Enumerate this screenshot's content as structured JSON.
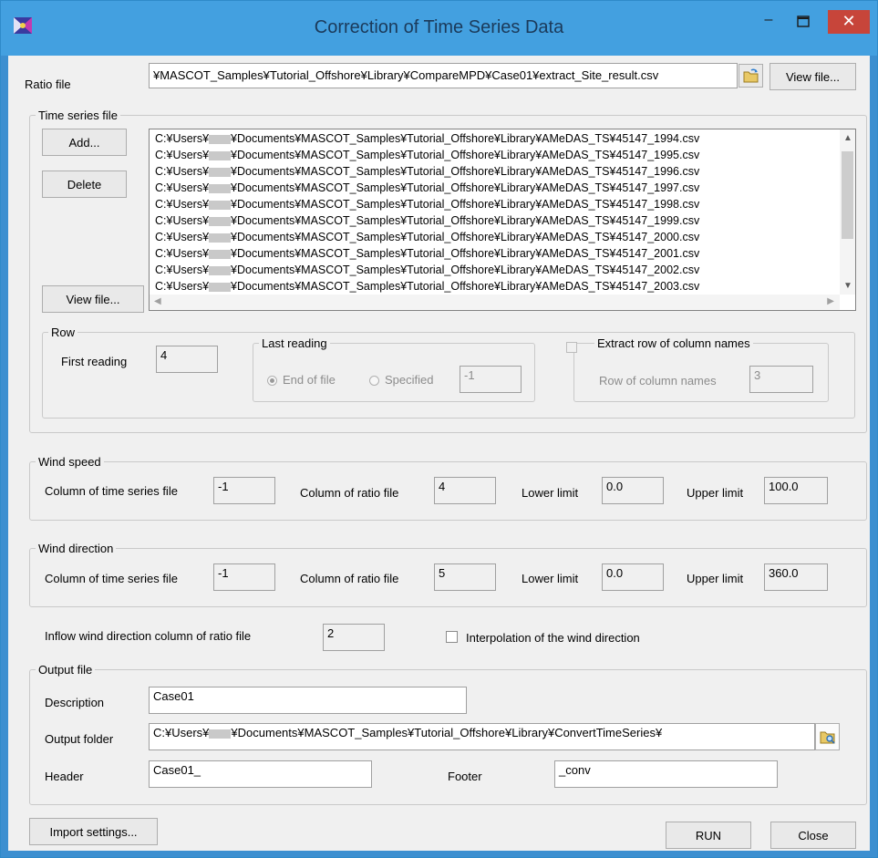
{
  "window": {
    "title": "Correction of Time Series Data",
    "minimize_glyph": "–",
    "maximize_glyph": "□",
    "close_glyph": "✕"
  },
  "ratio_file": {
    "label": "Ratio file",
    "value": "¥MASCOT_Samples¥Tutorial_Offshore¥Library¥CompareMPD¥Case01¥extract_Site_result.csv",
    "view_button": "View file..."
  },
  "time_series": {
    "legend": "Time series file",
    "add_button": "Add...",
    "delete_button": "Delete",
    "view_button": "View file...",
    "path_prefix": "C:¥Users¥",
    "path_suffix_base": "¥Documents¥MASCOT_Samples¥Tutorial_Offshore¥Library¥AMeDAS_TS¥",
    "files": [
      "45147_1994.csv",
      "45147_1995.csv",
      "45147_1996.csv",
      "45147_1997.csv",
      "45147_1998.csv",
      "45147_1999.csv",
      "45147_2000.csv",
      "45147_2001.csv",
      "45147_2002.csv",
      "45147_2003.csv"
    ]
  },
  "row": {
    "legend": "Row",
    "first_reading_label": "First reading",
    "first_reading_value": "4",
    "last_reading_legend": "Last reading",
    "end_of_file_label": "End of file",
    "specified_label": "Specified",
    "specified_value": "-1",
    "selected": "End of file",
    "extract_legend": "Extract row of column names",
    "row_of_column_names_label": "Row of column names",
    "row_of_column_names_value": "3"
  },
  "wind_speed": {
    "legend": "Wind speed",
    "col_ts_label": "Column of time series file",
    "col_ts_value": "-1",
    "col_ratio_label": "Column of ratio file",
    "col_ratio_value": "4",
    "lower_label": "Lower limit",
    "lower_value": "0.0",
    "upper_label": "Upper limit",
    "upper_value": "100.0"
  },
  "wind_direction": {
    "legend": "Wind direction",
    "col_ts_label": "Column of time series file",
    "col_ts_value": "-1",
    "col_ratio_label": "Column of ratio file",
    "col_ratio_value": "5",
    "lower_label": "Lower limit",
    "lower_value": "0.0",
    "upper_label": "Upper limit",
    "upper_value": "360.0"
  },
  "inflow": {
    "label": "Inflow wind direction column of ratio file",
    "value": "2",
    "interpolation_label": "Interpolation of the wind direction",
    "interpolation_checked": false
  },
  "output": {
    "legend": "Output file",
    "description_label": "Description",
    "description_value": "Case01",
    "folder_label": "Output folder",
    "folder_prefix": "C:¥Users¥",
    "folder_suffix": "¥Documents¥MASCOT_Samples¥Tutorial_Offshore¥Library¥ConvertTimeSeries¥",
    "header_label": "Header",
    "header_value": "Case01_",
    "footer_label": "Footer",
    "footer_value": "_conv"
  },
  "bottom": {
    "import_button": "Import settings...",
    "run_button": "RUN",
    "close_button": "Close"
  },
  "colors": {
    "titlebar": "#43a0e0",
    "close_button": "#c7453a",
    "client_bg": "#f0f0f0"
  }
}
